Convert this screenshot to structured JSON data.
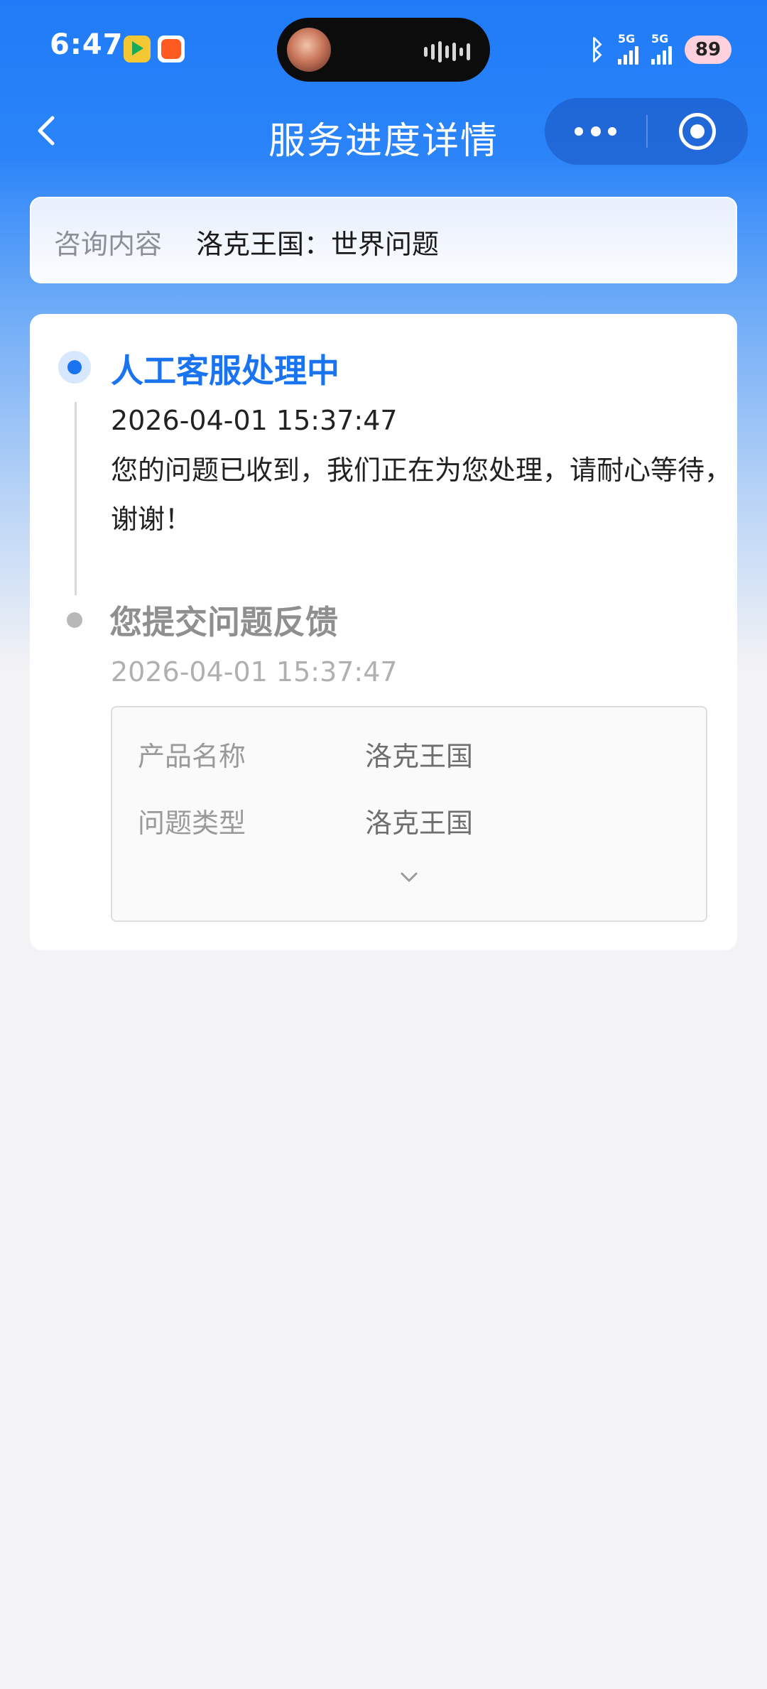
{
  "status_bar": {
    "time": "6:47",
    "network_1": "5G",
    "network_2": "5G",
    "battery": "89",
    "icons": [
      "video-app-icon",
      "red-app-icon",
      "bluetooth-icon",
      "signal-icon",
      "battery-icon"
    ]
  },
  "nav": {
    "title": "服务进度详情",
    "icons": [
      "back-arrow-icon",
      "more-dots-icon",
      "close-target-icon"
    ]
  },
  "inquiry": {
    "label": "咨询内容",
    "value": "洛克王国：世界问题"
  },
  "timeline": {
    "steps": [
      {
        "title": "人工客服处理中",
        "time": "2026-04-01 15:37:47",
        "description": "您的问题已收到，我们正在为您处理，请耐心等待，谢谢！",
        "active": true
      },
      {
        "title": "您提交问题反馈",
        "time": "2026-04-01 15:37:47",
        "active": false
      }
    ],
    "details": [
      {
        "label": "产品名称",
        "value": "洛克王国"
      },
      {
        "label": "问题类型",
        "value": "洛克王国"
      }
    ],
    "expand_icon": "chevron-down-icon"
  },
  "colors": {
    "primary_blue": "#1a73f0",
    "header_blue": "#1f7bf7",
    "page_bg": "#f3f3f5",
    "muted_text": "#8f8f8f"
  }
}
